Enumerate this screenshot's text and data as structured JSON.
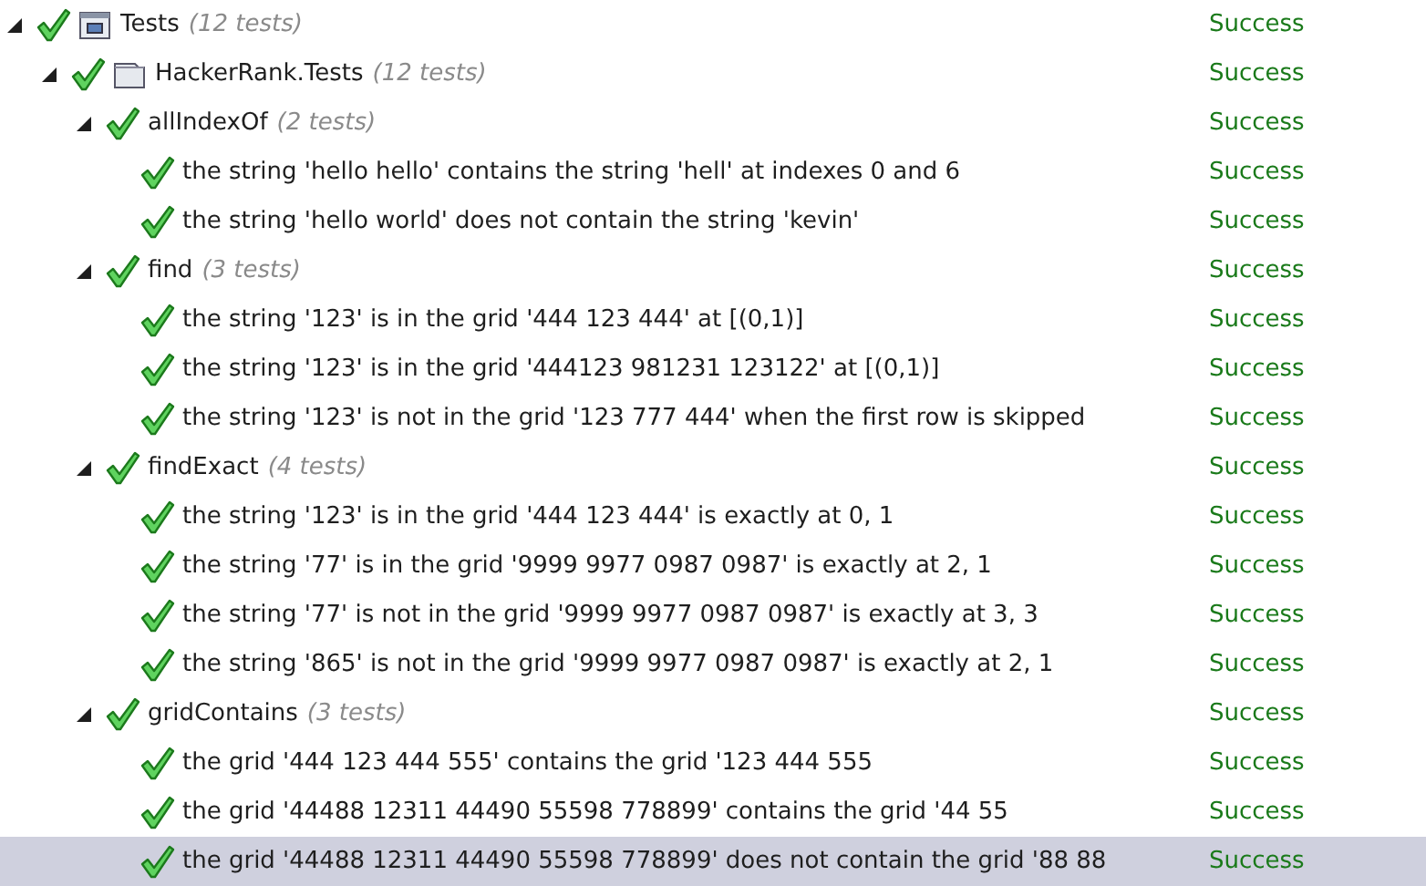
{
  "tree": [
    {
      "kind": "project",
      "name": "Tests",
      "count": "(12 tests)",
      "result": "Success",
      "passed": true,
      "expanded": true,
      "selected": false,
      "children": [
        {
          "kind": "namespace",
          "name": "HackerRank.Tests",
          "count": "(12 tests)",
          "result": "Success",
          "passed": true,
          "expanded": true,
          "selected": false,
          "children": [
            {
              "name": "allIndexOf",
              "count": "(2 tests)",
              "result": "Success",
              "passed": true,
              "expanded": true,
              "selected": false,
              "children": [
                {
                  "name": "the string 'hello hello' contains the string 'hell' at indexes 0 and 6",
                  "result": "Success",
                  "passed": true,
                  "selected": false
                },
                {
                  "name": "the string 'hello world' does not contain the string 'kevin'",
                  "result": "Success",
                  "passed": true,
                  "selected": false
                }
              ]
            },
            {
              "name": "find",
              "count": "(3 tests)",
              "result": "Success",
              "passed": true,
              "expanded": true,
              "selected": false,
              "children": [
                {
                  "name": "the string '123' is in the grid '444 123 444' at [(0,1)]",
                  "result": "Success",
                  "passed": true,
                  "selected": false
                },
                {
                  "name": "the string '123' is in the grid '444123 981231 123122' at [(0,1)]",
                  "result": "Success",
                  "passed": true,
                  "selected": false
                },
                {
                  "name": "the string '123' is not in the grid '123 777 444' when the first row is skipped",
                  "result": "Success",
                  "passed": true,
                  "selected": false
                }
              ]
            },
            {
              "name": "findExact",
              "count": "(4 tests)",
              "result": "Success",
              "passed": true,
              "expanded": true,
              "selected": false,
              "children": [
                {
                  "name": "the string '123' is in the grid '444 123 444' is exactly at 0, 1",
                  "result": "Success",
                  "passed": true,
                  "selected": false
                },
                {
                  "name": "the string '77' is in the grid '9999 9977 0987 0987' is exactly at 2, 1",
                  "result": "Success",
                  "passed": true,
                  "selected": false
                },
                {
                  "name": "the string '77' is not in the grid '9999 9977 0987 0987' is exactly at 3, 3",
                  "result": "Success",
                  "passed": true,
                  "selected": false
                },
                {
                  "name": "the string '865' is not in the grid '9999 9977 0987 0987' is exactly at 2, 1",
                  "result": "Success",
                  "passed": true,
                  "selected": false
                }
              ]
            },
            {
              "name": "gridContains",
              "count": "(3 tests)",
              "result": "Success",
              "passed": true,
              "expanded": true,
              "selected": false,
              "children": [
                {
                  "name": "the grid '444 123 444 555' contains the grid '123 444 555",
                  "result": "Success",
                  "passed": true,
                  "selected": false
                },
                {
                  "name": "the grid '44488 12311 44490 55598 778899' contains the grid '44 55",
                  "result": "Success",
                  "passed": true,
                  "selected": false
                },
                {
                  "name": "the grid '44488 12311 44490 55598 778899' does not contain the grid '88 88",
                  "result": "Success",
                  "passed": true,
                  "selected": true
                }
              ]
            }
          ]
        }
      ]
    }
  ]
}
